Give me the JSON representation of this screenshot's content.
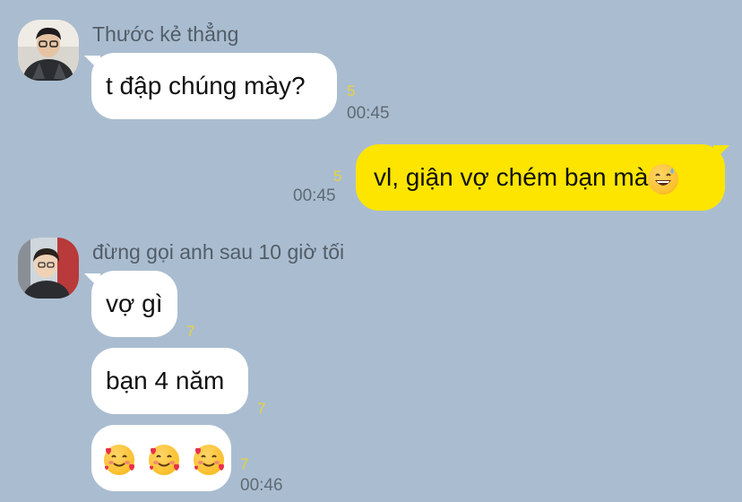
{
  "messages": [
    {
      "sender": "Thước kẻ thẳng",
      "text": "t đập chúng mày?",
      "unread": "5",
      "time": "00:45"
    },
    {
      "text": "vl, giận vợ chém bạn mà",
      "emoji": "grinning-sweat-emoji",
      "unread": "5",
      "time": "00:45"
    },
    {
      "sender": "đừng gọi anh sau 10 giờ tối",
      "group": [
        {
          "text": "vợ gì",
          "unread": "7"
        },
        {
          "text": "bạn 4 năm",
          "unread": "7"
        },
        {
          "emojis": [
            "smiling-face-with-hearts-emoji",
            "smiling-face-with-hearts-emoji",
            "smiling-face-with-hearts-emoji"
          ],
          "unread": "7",
          "time": "00:46"
        }
      ]
    }
  ],
  "colors": {
    "background": "#aabdd0",
    "incoming_bubble": "#ffffff",
    "outgoing_bubble": "#fde500",
    "unread_count": "#e8d23a",
    "timestamp": "#5f6a76"
  }
}
